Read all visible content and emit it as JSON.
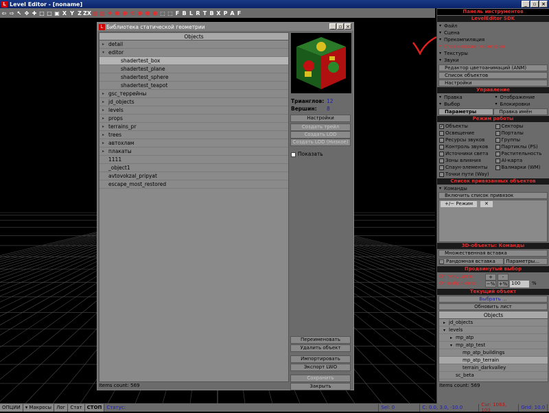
{
  "window": {
    "title": "Level Editor - [noname]",
    "logo": "L",
    "minimize": "_",
    "restore": "▫",
    "close": "×"
  },
  "toolbar": {
    "items": [
      "⇦",
      "⇨",
      "↖",
      "✥",
      "✚",
      "□",
      "□",
      "▣",
      "X",
      "Y",
      "Z",
      "ZX",
      "▧",
      "▧",
      "✚",
      "⬟",
      "⬟",
      "⟲",
      "⬟",
      "⬟",
      "⬟",
      "⬚",
      "⬚"
    ],
    "letters": [
      "F",
      "B",
      "L",
      "R",
      "T",
      "B",
      "X",
      "P",
      "A",
      "F"
    ]
  },
  "dialog": {
    "title": "Библиотека статической геометрии",
    "tree_header": "Objects",
    "rows": [
      {
        "label": "detail",
        "arrow": "▸",
        "indent": false,
        "selected": false
      },
      {
        "label": "editor",
        "arrow": "▾",
        "indent": false,
        "selected": false
      },
      {
        "label": "shadertest_box",
        "arrow": "",
        "indent": true,
        "selected": true
      },
      {
        "label": "shadertest_plane",
        "arrow": "",
        "indent": true,
        "selected": false
      },
      {
        "label": "shadertest_sphere",
        "arrow": "",
        "indent": true,
        "selected": false
      },
      {
        "label": "shadertest_teapot",
        "arrow": "",
        "indent": true,
        "selected": false
      },
      {
        "label": "gsc_террейны",
        "arrow": "▸",
        "indent": false,
        "selected": false
      },
      {
        "label": "jd_objects",
        "arrow": "▸",
        "indent": false,
        "selected": false
      },
      {
        "label": "levels",
        "arrow": "▸",
        "indent": false,
        "selected": false
      },
      {
        "label": "props",
        "arrow": "▸",
        "indent": false,
        "selected": false
      },
      {
        "label": "terrains_pr",
        "arrow": "▸",
        "indent": false,
        "selected": false
      },
      {
        "label": "trees",
        "arrow": "▸",
        "indent": false,
        "selected": false
      },
      {
        "label": "автохлам",
        "arrow": "▸",
        "indent": false,
        "selected": false
      },
      {
        "label": "плакаты",
        "arrow": "▸",
        "indent": false,
        "selected": false
      },
      {
        "label": "1111",
        "arrow": "",
        "indent": false,
        "selected": false
      },
      {
        "label": "_object1",
        "arrow": "",
        "indent": false,
        "selected": false
      },
      {
        "label": "avtovokzal_pripyat",
        "arrow": "",
        "indent": false,
        "selected": false
      },
      {
        "label": "escape_most_restored",
        "arrow": "",
        "indent": false,
        "selected": false
      }
    ],
    "items_count": "Items count: 569",
    "triangles_label": "Трианглов:",
    "triangles_value": "12",
    "vertices_label": "Вершин:",
    "vertices_value": "8",
    "settings_btn": "Настройки",
    "make_thumb_btn": "Создать трейл",
    "make_lod_q_btn": "Создать LOD (Качество)",
    "make_lod_l_btn": "Создать LOD (Низкое)",
    "show_label": "Показать",
    "rename_btn": "Переименовать",
    "delete_btn": "Удалить объект",
    "import_btn": "Импортировать",
    "export_btn": "Экспорт LWO",
    "save_btn": "Сохранить",
    "close_btn": "Закрыть"
  },
  "panel": {
    "title": "Панель инструментов",
    "sdk_header": "LevelEditor SDK",
    "menu": [
      {
        "label": "Файл",
        "red": false
      },
      {
        "label": "Сцена",
        "red": false
      },
      {
        "label": "Прекомпиляция",
        "red": false
      },
      {
        "label": "Статическая геометрия",
        "red": true
      },
      {
        "label": "Текстуры",
        "red": false
      },
      {
        "label": "Звуки",
        "red": false
      }
    ],
    "tool_buttons": [
      "Редактор цветоанимаций (ANM)",
      "Список объектов",
      "Настройки"
    ],
    "control_header": "Управление",
    "control_left": [
      "Правка",
      "Выбор"
    ],
    "control_right": [
      "Отображение",
      "Блокировки"
    ],
    "tab_params": "Параметры",
    "tab_names": "Правка имён",
    "mode_header": "Режим работы",
    "mode_left": [
      "Объекты",
      "Освещение",
      "Ресурсы звуков",
      "Контроль звуков",
      "Источники света",
      "Зоны влияния",
      "Спаун-элементы",
      "Точки пути (Way)"
    ],
    "mode_right": [
      "Секторы",
      "Порталы",
      "Группы",
      "Партиклы (PS)",
      "Растительность",
      "AI-карта",
      "Валмарки (WM)"
    ],
    "bindings_header": "Список привязанных объектов",
    "commands_label": "Команды",
    "enable_bindings_btn": "Включить список привязок",
    "mode_tab": "+/− Режим",
    "mode_x": "✕",
    "objects3d_header": "3D-объекты: Команды",
    "multi_insert_btn": "Множественная вставка",
    "random_insert_label": "Рандомная вставка",
    "params_btn": "Параметры...",
    "adv_select_header": "Продвинутый выбор",
    "from_current_label": "От текущего:",
    "from_selected_label": "От выбраного:",
    "plus_btn": "+",
    "minus_btn": "-",
    "minus_pct_btn": "−%",
    "plus_pct_btn": "+%",
    "percent_value": "100",
    "percent_sign": "%",
    "current_header": "Текущий объект",
    "select_btn": "Выбрать ...",
    "refresh_btn": "Обновить лист",
    "tree_header": "Objects",
    "tree_rows": [
      {
        "label": "jd_objects",
        "arrow": "▸",
        "level": 0
      },
      {
        "label": "levels",
        "arrow": "▾",
        "level": 0
      },
      {
        "label": "mp_atp",
        "arrow": "▸",
        "level": 1
      },
      {
        "label": "mp_atp_test",
        "arrow": "▾",
        "level": 1
      },
      {
        "label": "mp_atp_buildings",
        "arrow": "",
        "level": 2
      },
      {
        "label": "mp_atp_terrain",
        "arrow": "",
        "level": 2
      },
      {
        "label": "terrain_darkvalley",
        "arrow": "",
        "level": 2
      },
      {
        "label": "sc_beta",
        "arrow": "",
        "level": 1
      }
    ],
    "items_count": "Items count: 569"
  },
  "status": {
    "options": "ОПЦИИ",
    "macros": "▾ Макросы",
    "log": "Лог",
    "stat": "Стат",
    "stop": "СТОП",
    "status_label": "Статус:",
    "sel": "Sel: 0",
    "coord": "C: 0.0, 3.0, -10.0",
    "cur": "Cur: 1063, 103",
    "grid": "Grid: 10.0"
  },
  "colors": {
    "accent_red": "#e03030",
    "value_blue": "#1a1ab0"
  }
}
